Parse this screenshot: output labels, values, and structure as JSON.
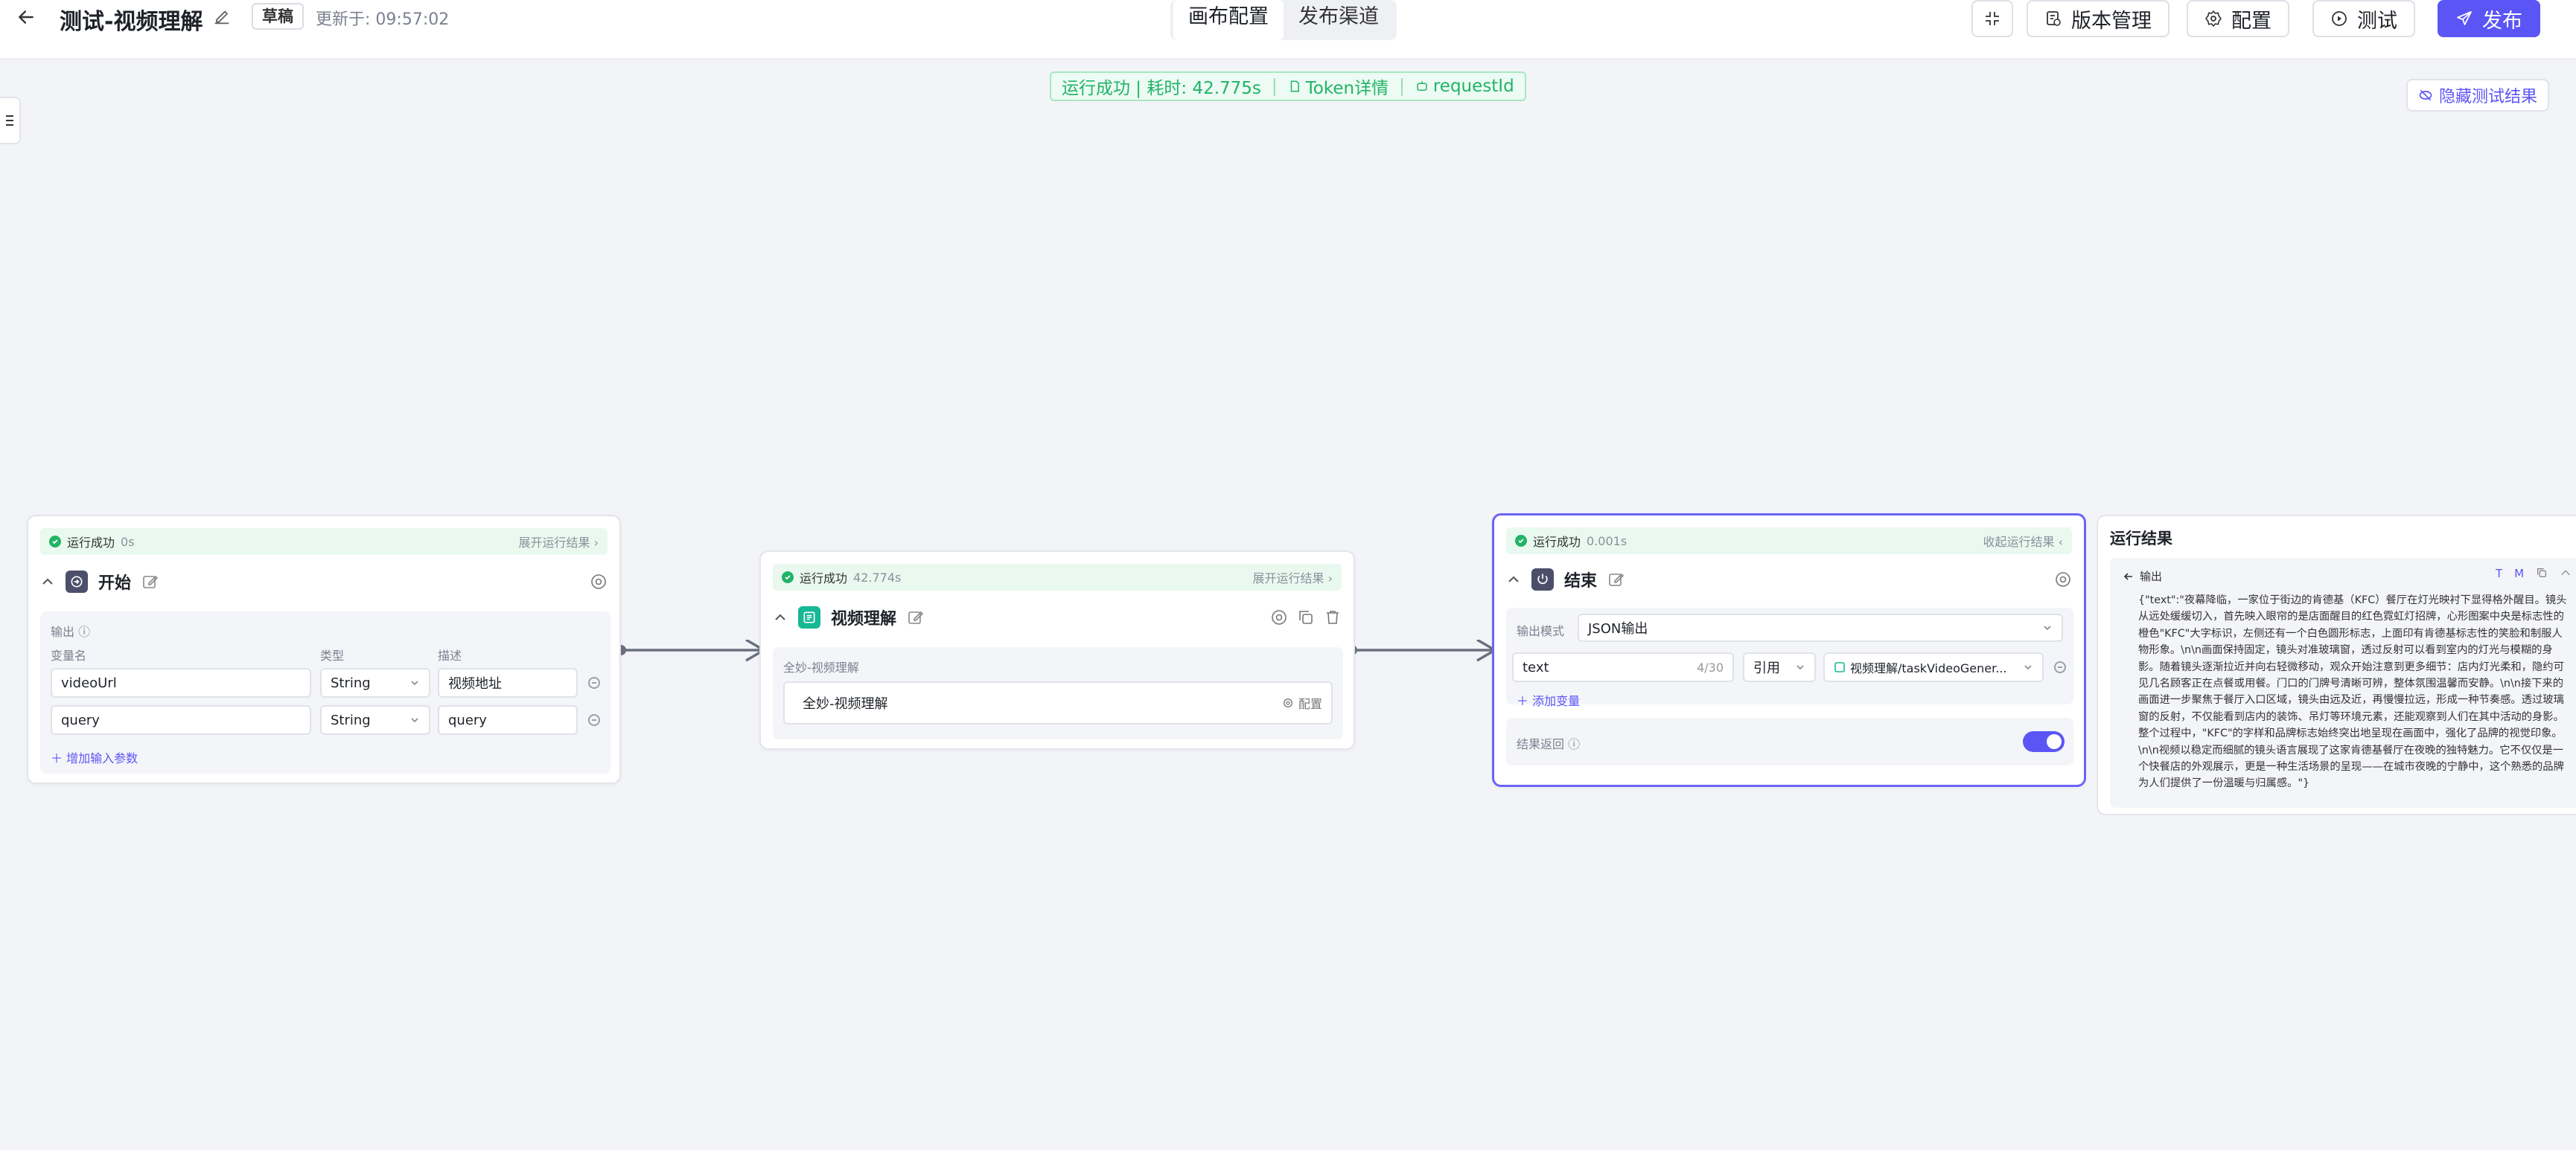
{
  "header": {
    "title": "测试-视频理解",
    "draft_badge": "草稿",
    "updated_label": "更新于:",
    "updated_time": "09:57:02",
    "tabs": [
      "画布配置",
      "发布渠道"
    ],
    "active_tab": "画布配置",
    "buttons": {
      "version": "版本管理",
      "config": "配置",
      "test": "测试",
      "publish": "发布"
    }
  },
  "run_status": {
    "text": "运行成功",
    "time_label": "耗时:",
    "time_value": "42.775s",
    "token": "Token详情",
    "request": "requestId"
  },
  "hide_results": "隐藏测试结果",
  "nodes": {
    "start": {
      "status": "运行成功",
      "duration": "0s",
      "expand": "展开运行结果",
      "title": "开始",
      "output_label": "输出",
      "columns": [
        "变量名",
        "类型",
        "描述"
      ],
      "params": [
        {
          "name": "videoUrl",
          "type": "String",
          "desc": "视频地址"
        },
        {
          "name": "query",
          "type": "String",
          "desc": "query"
        }
      ],
      "add_param": "增加输入参数"
    },
    "video": {
      "status": "运行成功",
      "duration": "42.774s",
      "expand": "展开运行结果",
      "title": "视频理解",
      "section_label": "全妙-视频理解",
      "item_name": "全妙-视频理解",
      "config": "配置"
    },
    "end": {
      "status": "运行成功",
      "duration": "0.001s",
      "collapse": "收起运行结果",
      "title": "结束",
      "output_mode_label": "输出模式",
      "output_mode": "JSON输出",
      "var_name": "text",
      "var_count": "4/30",
      "ref_type": "引用",
      "ref_value": "视频理解/taskVideoGener...",
      "add_var": "添加变量",
      "return_label": "结果返回",
      "return_enabled": true
    }
  },
  "result_panel": {
    "title": "运行结果",
    "output_label": "输出",
    "tools": [
      "T",
      "M"
    ],
    "text": "{\"text\":\"夜幕降临，一家位于街边的肯德基（KFC）餐厅在灯光映衬下显得格外醒目。镜头从远处缓缓切入，首先映入眼帘的是店面醒目的红色霓虹灯招牌，心形图案中央是标志性的橙色\"KFC\"大字标识，左侧还有一个白色圆形标志，上面印有肯德基标志性的笑脸和制服人物形象。\\n\\n画面保持固定，镜头对准玻璃窗，透过反射可以看到室内的灯光与模糊的身影。随着镜头逐渐拉近并向右轻微移动，观众开始注意到更多细节：店内灯光柔和，隐约可见几名顾客正在点餐或用餐。门口的门牌号清晰可辨，整体氛围温馨而安静。\\n\\n接下来的画面进一步聚焦于餐厅入口区域，镜头由远及近，再慢慢拉远，形成一种节奏感。透过玻璃窗的反射，不仅能看到店内的装饰、吊灯等环境元素，还能观察到人们在其中活动的身影。整个过程中，\"KFC\"的字样和品牌标志始终突出地呈现在画面中，强化了品牌的视觉印象。\\n\\n视频以稳定而细腻的镜头语言展现了这家肯德基餐厅在夜晚的独特魅力。它不仅仅是一个快餐店的外观展示，更是一种生活场景的呈现——在城市夜晚的宁静中，这个熟悉的品牌为人们提供了一份温暖与归属感。\"}"
  },
  "colors": {
    "accent": "#5b55f6",
    "success": "#22b366",
    "start_icon": "#4b4f6a",
    "video_icon": "#17b894"
  }
}
